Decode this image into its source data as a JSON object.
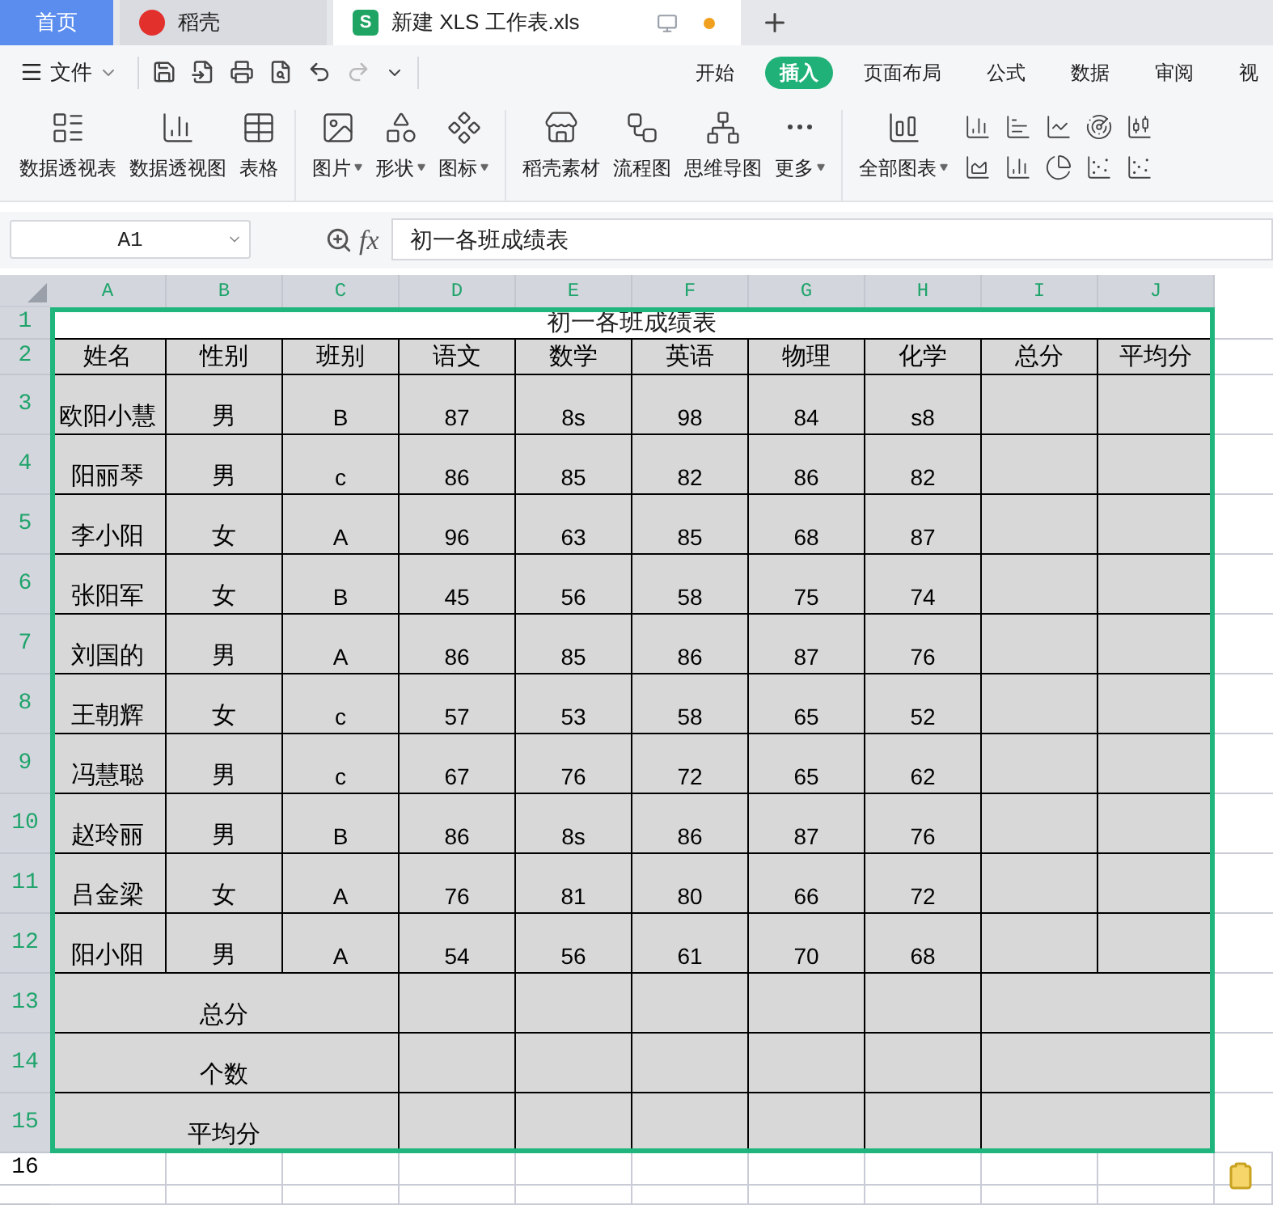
{
  "tabs": [
    {
      "kind": "home",
      "label": "首页",
      "selected": false
    },
    {
      "kind": "app",
      "label": "稻壳",
      "selected": false
    },
    {
      "kind": "doc",
      "label": "新建 XLS 工作表.xls",
      "icon_letter": "S",
      "selected": true,
      "unsaved": true
    }
  ],
  "file_menu": "文件",
  "ribbon_tabs": [
    {
      "label": "开始",
      "selected": false
    },
    {
      "label": "插入",
      "selected": true
    },
    {
      "label": "页面布局",
      "selected": false
    },
    {
      "label": "公式",
      "selected": false
    },
    {
      "label": "数据",
      "selected": false
    },
    {
      "label": "审阅",
      "selected": false
    },
    {
      "label": "视",
      "selected": false
    }
  ],
  "ribbon_tools": [
    {
      "label": "数据透视表",
      "dropdown": false
    },
    {
      "label": "数据透视图",
      "dropdown": false
    },
    {
      "label": "表格",
      "dropdown": false
    },
    {
      "label": "图片",
      "dropdown": true
    },
    {
      "label": "形状",
      "dropdown": true
    },
    {
      "label": "图标",
      "dropdown": true
    },
    {
      "label": "稻壳素材",
      "dropdown": false
    },
    {
      "label": "流程图",
      "dropdown": false
    },
    {
      "label": "思维导图",
      "dropdown": false
    },
    {
      "label": "更多",
      "dropdown": true
    },
    {
      "label": "全部图表",
      "dropdown": true
    }
  ],
  "name_box": "A1",
  "fx_label": "fx",
  "formula": "初一各班成绩表",
  "column_letters": [
    "A",
    "B",
    "C",
    "D",
    "E",
    "F",
    "G",
    "H",
    "I",
    "J"
  ],
  "row_numbers": [
    {
      "label": "1",
      "selected": true
    },
    {
      "label": "2",
      "selected": true
    },
    {
      "label": "3",
      "selected": true
    },
    {
      "label": "4",
      "selected": true
    },
    {
      "label": "5",
      "selected": true
    },
    {
      "label": "6",
      "selected": true
    },
    {
      "label": "7",
      "selected": true
    },
    {
      "label": "8",
      "selected": true
    },
    {
      "label": "9",
      "selected": true
    },
    {
      "label": "10",
      "selected": true
    },
    {
      "label": "11",
      "selected": true
    },
    {
      "label": "12",
      "selected": true
    },
    {
      "label": "13",
      "selected": true
    },
    {
      "label": "14",
      "selected": true
    },
    {
      "label": "15",
      "selected": true
    },
    {
      "label": "16",
      "selected": false
    }
  ],
  "sheet": {
    "title": "初一各班成绩表",
    "headers": [
      "姓名",
      "性别",
      "班别",
      "语文",
      "数学",
      "英语",
      "物理",
      "化学",
      "总分",
      "平均分"
    ],
    "rows": [
      [
        "欧阳小慧",
        "男",
        "B",
        "87",
        "8s",
        "98",
        "84",
        "s8"
      ],
      [
        "阳丽琴",
        "男",
        "c",
        "86",
        "85",
        "82",
        "86",
        "82"
      ],
      [
        "李小阳",
        "女",
        "A",
        "96",
        "63",
        "85",
        "68",
        "87"
      ],
      [
        "张阳军",
        "女",
        "B",
        "45",
        "56",
        "58",
        "75",
        "74"
      ],
      [
        "刘国的",
        "男",
        "A",
        "86",
        "85",
        "86",
        "87",
        "76"
      ],
      [
        "王朝辉",
        "女",
        "c",
        "57",
        "53",
        "58",
        "65",
        "52"
      ],
      [
        "冯慧聪",
        "男",
        "c",
        "67",
        "76",
        "72",
        "65",
        "62"
      ],
      [
        "赵玲丽",
        "男",
        "B",
        "86",
        "8s",
        "86",
        "87",
        "76"
      ],
      [
        "吕金梁",
        "女",
        "A",
        "76",
        "81",
        "80",
        "66",
        "72"
      ],
      [
        "阳小阳",
        "男",
        "A",
        "54",
        "56",
        "61",
        "70",
        "68"
      ]
    ],
    "summary_rows": [
      "总分",
      "个数",
      "平均分"
    ]
  }
}
